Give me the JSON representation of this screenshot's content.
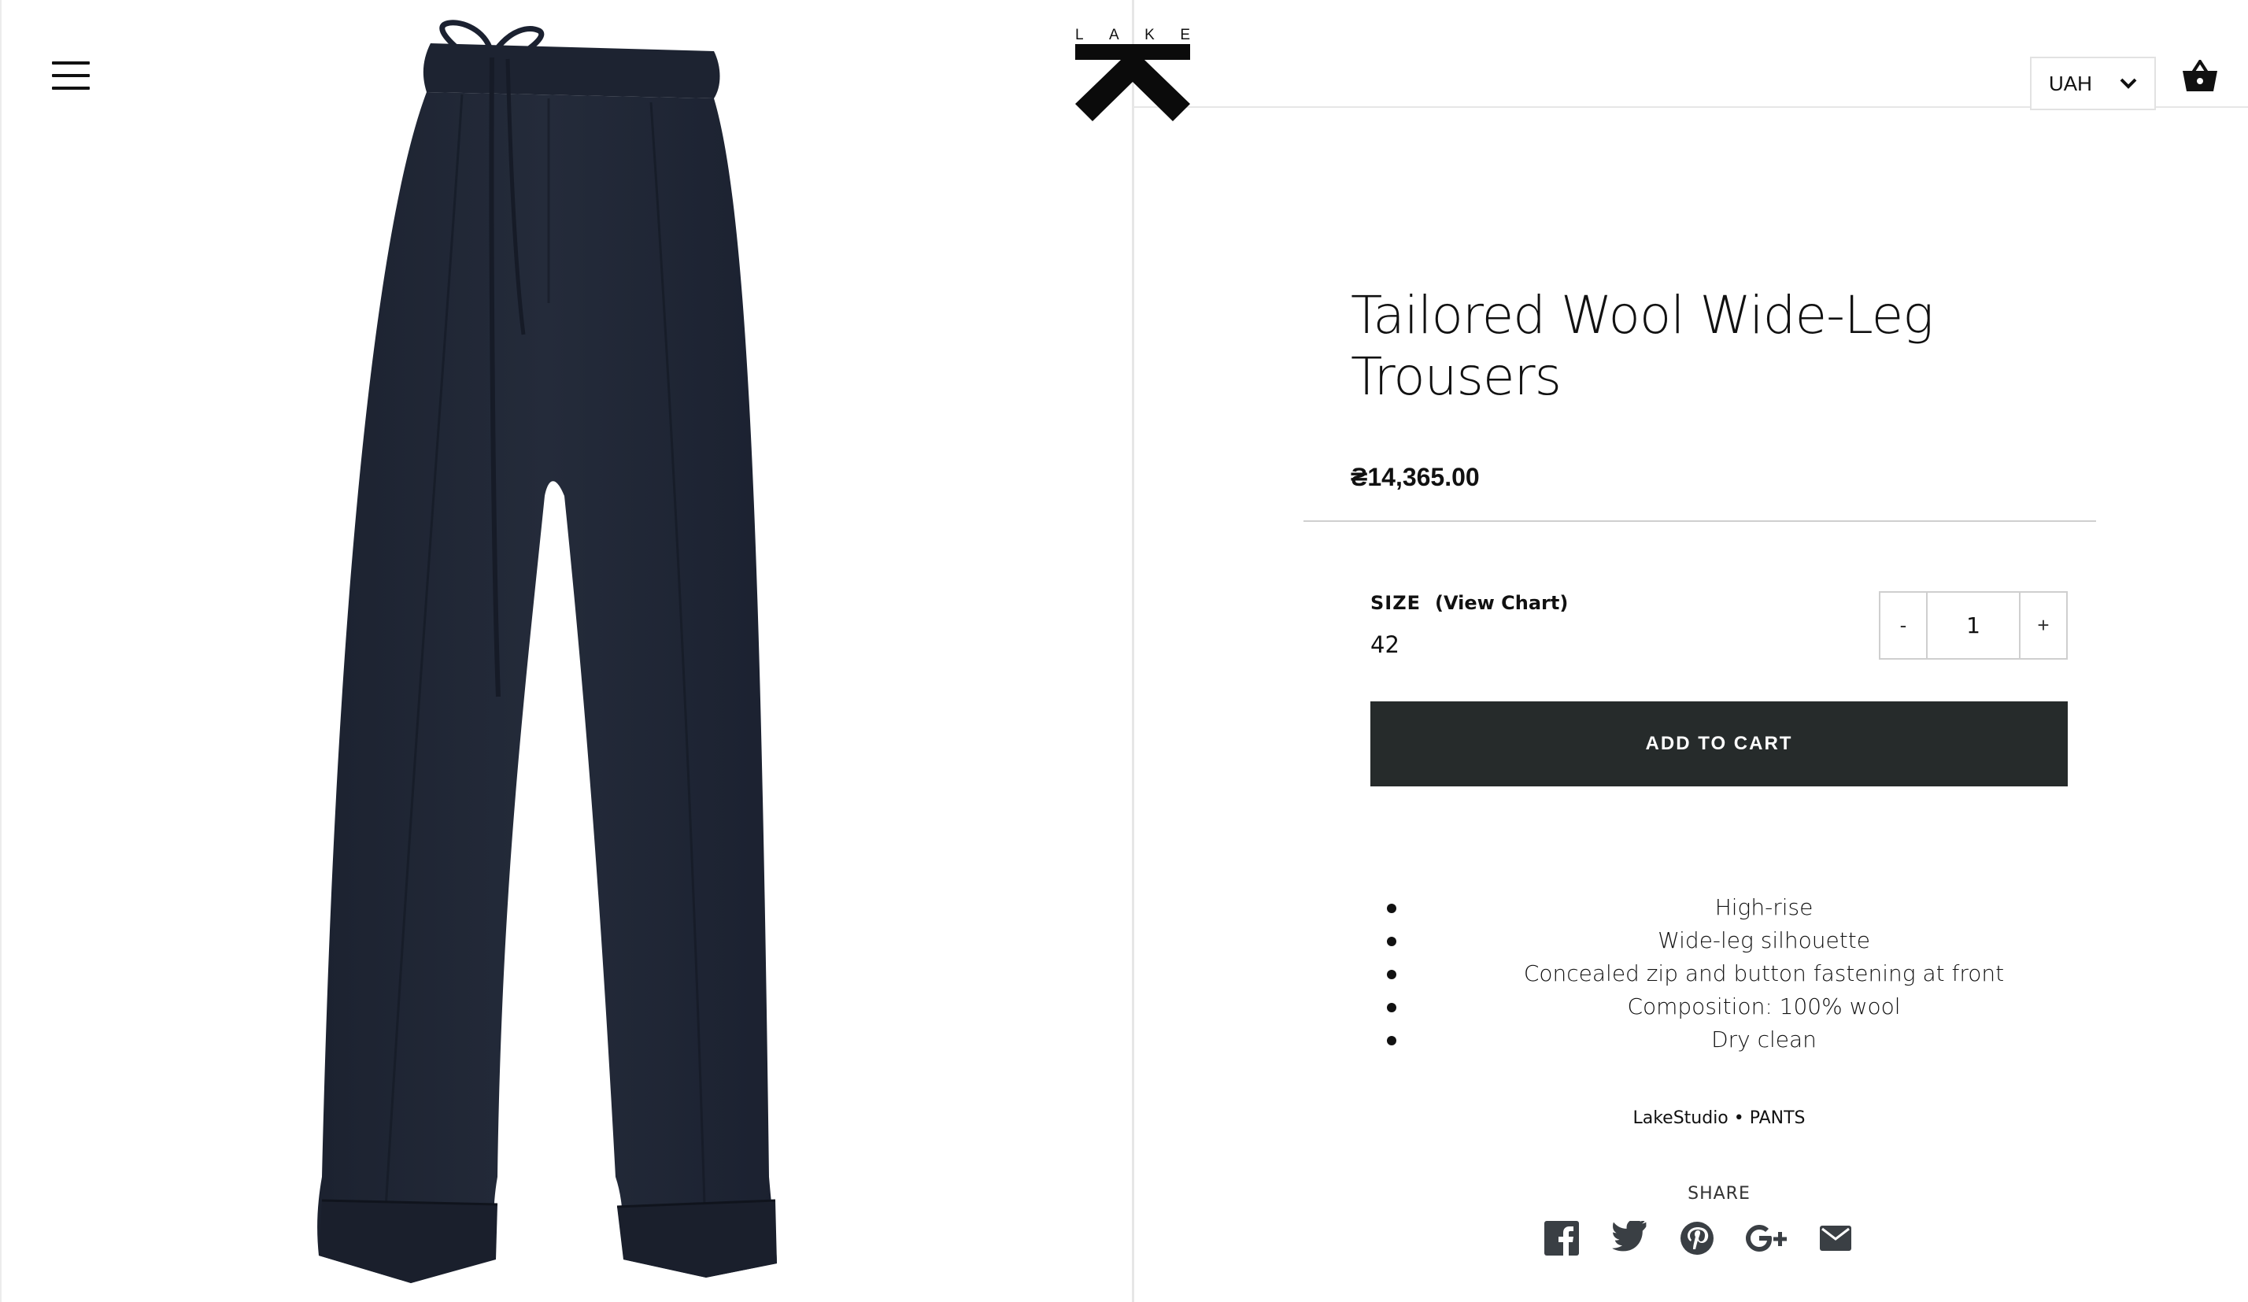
{
  "brand": {
    "logo_letters": [
      "L",
      "A",
      "K",
      "E"
    ]
  },
  "header": {
    "currency": "UAH",
    "menu_icon": "hamburger-menu-icon",
    "cart_icon": "basket-icon"
  },
  "product": {
    "title_line1": "Tailored Wool Wide-Leg",
    "title_line2": "Trousers",
    "price": "₴14,365.00",
    "size_label": "SIZE",
    "size_chart_link": "(View Chart)",
    "size_value": "42",
    "quantity": "1",
    "qty_minus": "-",
    "qty_plus": "+",
    "add_to_cart": "ADD TO CART",
    "features": [
      "High-rise",
      "Wide-leg silhouette",
      "Concealed zip and button fastening at front",
      "Composition: 100% wool",
      "Dry clean"
    ],
    "meta": "LakeStudio • PANTS",
    "image_alt": "navy wide-leg trousers"
  },
  "share": {
    "label": "SHARE",
    "icons": [
      "facebook-icon",
      "twitter-icon",
      "pinterest-icon",
      "google-plus-icon",
      "email-icon"
    ]
  },
  "colors": {
    "button_bg": "#262b2b",
    "trousers": "#1f2533",
    "share_icons": "#3a3f44"
  }
}
